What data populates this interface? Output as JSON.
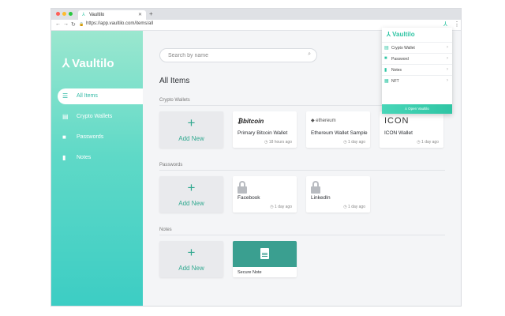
{
  "browser": {
    "tab_title": "Vaultilo",
    "tab_close": "✕",
    "new_tab": "+",
    "url": "https://app.vaultilo.com/items/all",
    "nav_back": "←",
    "nav_forward": "→",
    "nav_reload": "↻",
    "lock": "🔒",
    "menu": "⋮",
    "traffic_colors": [
      "#ff5f57",
      "#febc2e",
      "#28c840"
    ]
  },
  "brand": {
    "name": "Vaultilo",
    "mark": "⅄",
    "accent": "#2fc5a4"
  },
  "sidebar": {
    "items": [
      {
        "label": "All Items",
        "icon": "☰"
      },
      {
        "label": "Crypto Wallets",
        "icon": "▤"
      },
      {
        "label": "Passwords",
        "icon": "■"
      },
      {
        "label": "Notes",
        "icon": "▮"
      }
    ]
  },
  "search": {
    "placeholder": "Search by name",
    "icon": "⌕"
  },
  "main": {
    "title": "All Items",
    "add_label": "Add New",
    "add_plus": "+",
    "clock": "◷",
    "sections": [
      {
        "label": "Crypto Wallets",
        "items": [
          {
            "logo": "₿bitcoin",
            "title": "Primary Bitcoin Wallet",
            "time": "18 hours ago"
          },
          {
            "logo": "◆ ethereum",
            "title": "Ethereum Wallet Sample",
            "time": "1 day ago"
          },
          {
            "logo": "ICON",
            "title": "ICON Wallet",
            "time": "1 day ago"
          }
        ]
      },
      {
        "label": "Passwords",
        "items": [
          {
            "title": "Facebook",
            "time": "1 day ago"
          },
          {
            "title": "LinkedIn",
            "time": "1 day ago"
          }
        ]
      },
      {
        "label": "Notes",
        "items": [
          {
            "title": "Secure Note"
          }
        ]
      }
    ],
    "next_arrow": "›"
  },
  "popup": {
    "items": [
      {
        "label": "Crypto Wallet",
        "icon": "▤"
      },
      {
        "label": "Password",
        "icon": "■"
      },
      {
        "label": "Notes",
        "icon": "▮"
      },
      {
        "label": "NFT",
        "icon": "▦"
      }
    ],
    "arrow": "›",
    "footer": "⅄ Open Vaultilo"
  }
}
